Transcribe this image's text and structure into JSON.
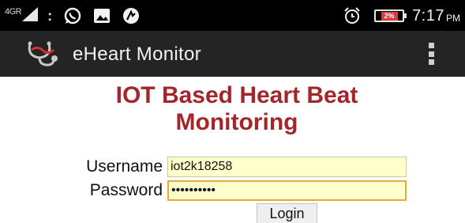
{
  "status_bar": {
    "network_type": "4GR",
    "overflow_dots": ":",
    "battery_level": "2%",
    "battery_color": "#e23a3a",
    "time": "7:17",
    "ampm": "PM",
    "icons": [
      "signal-icon",
      "whatsapp-icon",
      "gallery-icon",
      "hike-icon",
      "alarm-icon",
      "battery-icon"
    ]
  },
  "app_bar": {
    "title": "eHeart Monitor",
    "logo": "stethoscope-logo-icon",
    "menu_icon": "overflow-menu-icon",
    "background": "#242424"
  },
  "page": {
    "heading": "IOT Based Heart Beat Monitoring",
    "heading_color": "#a3262b"
  },
  "form": {
    "username_label": "Username",
    "username_value": "iot2k18258",
    "password_label": "Password",
    "password_value": "iot2k18258",
    "login_label": "Login"
  }
}
